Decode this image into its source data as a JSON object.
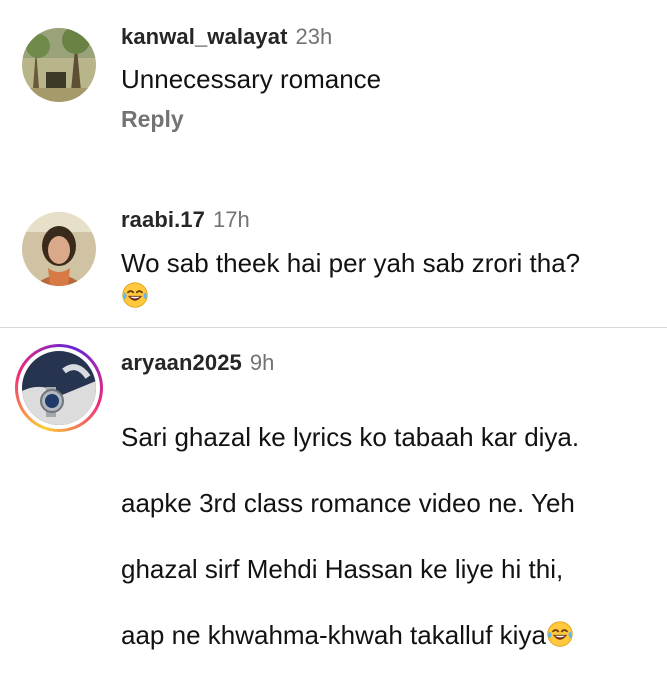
{
  "comments": [
    {
      "username": "kanwal_walayat",
      "time": "23h",
      "text": "Unnecessary romance",
      "reply_label": "Reply",
      "avatar_icon": "landscape-avatar-icon"
    },
    {
      "username": "raabi.17",
      "time": "17h",
      "text": "Wo sab theek hai per yah sab zrori tha?",
      "emoji": "tears-of-joy-emoji",
      "avatar_icon": "person-avatar-icon"
    },
    {
      "username": "aryaan2025",
      "time": "9h",
      "text_lines": [
        "Sari ghazal ke lyrics ko tabaah kar diya.",
        "aapke 3rd class romance video ne. Yeh",
        "ghazal sirf Mehdi Hassan ke liye hi thi,",
        "aap ne khwahma-khwah takalluf kiya"
      ],
      "emoji": "tears-of-joy-emoji",
      "avatar_icon": "watch-avatar-icon",
      "has_story_ring": true
    }
  ],
  "colors": {
    "username": "#262626",
    "meta": "#737373",
    "body_text": "#121212",
    "divider": "#d8d8d8",
    "emoji_face": "#ffc83d",
    "emoji_tear": "#5fb7f0"
  }
}
